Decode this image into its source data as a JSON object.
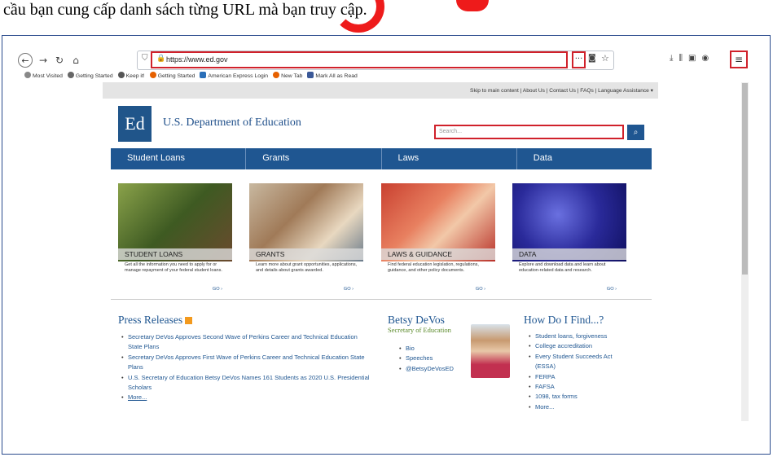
{
  "caption": "cầu bạn cung cấp danh sách từng URL mà bạn truy cập.",
  "browser": {
    "url": "https://www.ed.gov",
    "bookmarks": [
      "Most Visited",
      "Getting Started",
      "Keep it!",
      "Getting Started",
      "American Express Login",
      "New Tab",
      "Mark All as Read"
    ]
  },
  "site": {
    "utility_links": "Skip to main content | About Us | Contact Us | FAQs | Language Assistance ▾",
    "logo_text": "Ed",
    "department": "U.S. Department of Education",
    "search_placeholder": "Search...",
    "nav": [
      "Student Loans",
      "Grants",
      "Laws",
      "Data"
    ],
    "cards": [
      {
        "title": "Student Loans",
        "desc": "Get all the information you need to apply for or manage repayment of your federal student loans.",
        "go": "GO ›"
      },
      {
        "title": "Grants",
        "desc": "Learn more about grant opportunities, applications, and details about grants awarded.",
        "go": "GO ›"
      },
      {
        "title": "Laws & Guidance",
        "desc": "Find federal education legislation, regulations, guidance, and other policy documents.",
        "go": "GO ›"
      },
      {
        "title": "Data",
        "desc": "Explore and download data and learn about education-related data and research.",
        "go": "GO ›"
      }
    ],
    "press": {
      "title": "Press Releases",
      "items": [
        "Secretary DeVos Approves Second Wave of Perkins Career and Technical Education State Plans",
        "Secretary DeVos Approves First Wave of Perkins Career and Technical Education State Plans",
        "U.S. Secretary of Education Betsy DeVos Names 161 Students as 2020 U.S. Presidential Scholars",
        "More..."
      ]
    },
    "secretary": {
      "name": "Betsy DeVos",
      "role": "Secretary of Education",
      "links": [
        "Bio",
        "Speeches",
        "@BetsyDeVosED"
      ]
    },
    "find": {
      "title": "How Do I Find...?",
      "items": [
        "Student loans, forgiveness",
        "College accreditation",
        "Every Student Succeeds Act (ESSA)",
        "FERPA",
        "FAFSA",
        "1098, tax forms",
        "More..."
      ]
    }
  }
}
